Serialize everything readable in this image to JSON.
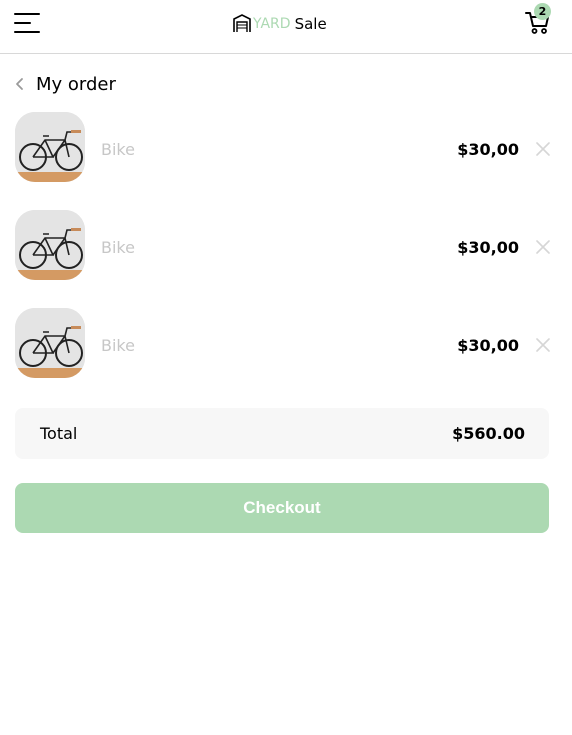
{
  "navbar": {
    "logo_yard": "YARD",
    "logo_sale": "Sale",
    "cart_count": "2",
    "icons": {
      "menu": "hamburger-menu-icon",
      "cart": "shopping-cart-icon",
      "logo": "yard-sale-logo-icon"
    }
  },
  "order": {
    "title": "My order",
    "back_icon": "chevron-left-icon"
  },
  "items": [
    {
      "name": "Bike",
      "price": "$30,00",
      "image": "bike-image"
    },
    {
      "name": "Bike",
      "price": "$30,00",
      "image": "bike-image"
    },
    {
      "name": "Bike",
      "price": "$30,00",
      "image": "bike-image"
    }
  ],
  "summary": {
    "total_label": "Total",
    "total_value": "$560.00"
  },
  "checkout": {
    "label": "Checkout"
  },
  "colors": {
    "accent": "#acd9b2",
    "muted_text": "#c7c7c7",
    "total_bg": "#f7f7f7",
    "divider": "#d8d8d8"
  }
}
